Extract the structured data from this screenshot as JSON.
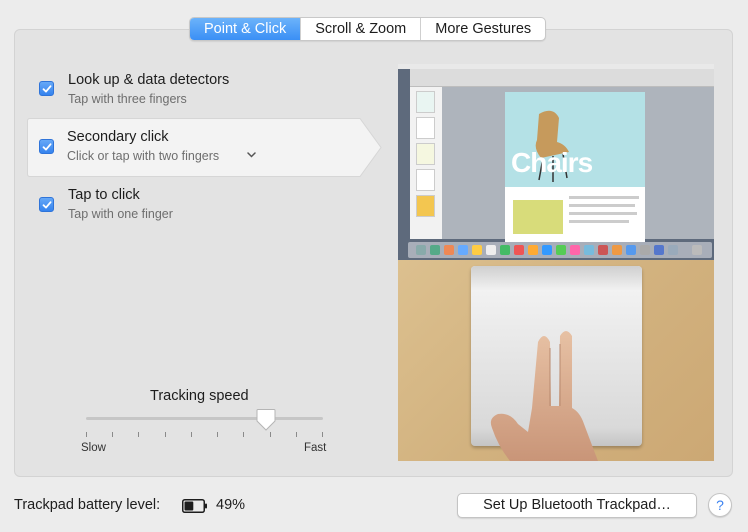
{
  "tabs": [
    {
      "label": "Point & Click",
      "active": true
    },
    {
      "label": "Scroll & Zoom",
      "active": false
    },
    {
      "label": "More Gestures",
      "active": false
    }
  ],
  "options": [
    {
      "title": "Look up & data detectors",
      "subtitle": "Tap with three fingers",
      "checked": true
    },
    {
      "title": "Secondary click",
      "subtitle": "Click or tap with two fingers",
      "checked": true,
      "has_dropdown": true,
      "selected": true
    },
    {
      "title": "Tap to click",
      "subtitle": "Tap with one finger",
      "checked": true
    }
  ],
  "tracking": {
    "label": "Tracking speed",
    "min_label": "Slow",
    "max_label": "Fast",
    "tick_count": 10,
    "value_fraction": 0.76
  },
  "preview": {
    "document_text": "Chairs",
    "icons": [
      "checkbox-icon",
      "chevron-down-icon",
      "battery-icon",
      "help-icon"
    ]
  },
  "footer": {
    "battery_label": "Trackpad battery level:",
    "battery_percent": "49%",
    "battery_level": 0.49,
    "bluetooth_button": "Set Up Bluetooth Trackpad…",
    "help_label": "?"
  },
  "colors": {
    "accent": "#3a8ff5",
    "panel": "#e3e3e3",
    "window": "#ececec"
  }
}
